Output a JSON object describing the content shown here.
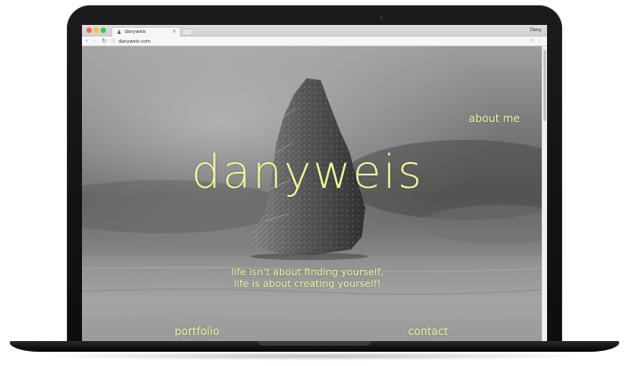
{
  "browser": {
    "tab_title": "danyweis",
    "tab_close": "×",
    "profile_name": "Dany",
    "url": "danyweis.com",
    "back": "‹",
    "forward": "›",
    "reload": "↻",
    "star": "☆",
    "menu": "⋮",
    "info_icon": "ⓘ"
  },
  "site": {
    "logo": "danyweis",
    "nav": {
      "about": "about me",
      "portfolio": "portfolio",
      "contact": "contact"
    },
    "tagline": [
      "life isn't about finding yourself,",
      "life is about creating yourself!"
    ]
  },
  "colors": {
    "accent_text": "#f2f29b",
    "laptop_body": "#111112"
  },
  "icons": {
    "favicon": "person-silhouette-icon",
    "back": "arrow-left-icon",
    "forward": "arrow-right-icon",
    "reload": "reload-icon",
    "bookmark": "star-icon",
    "menu": "kebab-menu-icon"
  }
}
